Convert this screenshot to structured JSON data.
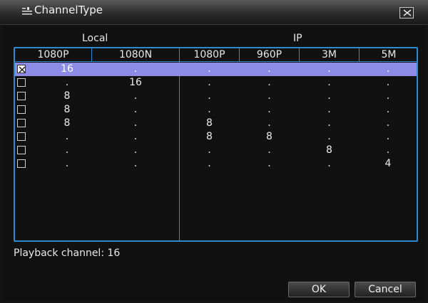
{
  "window": {
    "title": "ChannelType",
    "close_icon": "close-icon"
  },
  "groups": {
    "local": "Local",
    "ip": "IP"
  },
  "columns": [
    "1080P",
    "1080N",
    "1080P",
    "960P",
    "3M",
    "5M"
  ],
  "rows": [
    {
      "checked": true,
      "selected": true,
      "cells": [
        "16",
        ".",
        ".",
        ".",
        ".",
        "."
      ]
    },
    {
      "checked": false,
      "selected": false,
      "cells": [
        ".",
        "16",
        ".",
        ".",
        ".",
        "."
      ]
    },
    {
      "checked": false,
      "selected": false,
      "cells": [
        "8",
        ".",
        ".",
        ".",
        ".",
        "."
      ]
    },
    {
      "checked": false,
      "selected": false,
      "cells": [
        "8",
        ".",
        ".",
        ".",
        ".",
        "."
      ]
    },
    {
      "checked": false,
      "selected": false,
      "cells": [
        "8",
        ".",
        "8",
        ".",
        ".",
        "."
      ]
    },
    {
      "checked": false,
      "selected": false,
      "cells": [
        ".",
        ".",
        "8",
        "8",
        ".",
        "."
      ]
    },
    {
      "checked": false,
      "selected": false,
      "cells": [
        ".",
        ".",
        ".",
        ".",
        "8",
        "."
      ]
    },
    {
      "checked": false,
      "selected": false,
      "cells": [
        ".",
        ".",
        ".",
        ".",
        ".",
        "4"
      ]
    }
  ],
  "playback": "Playback channel: 16",
  "buttons": {
    "ok": "OK",
    "cancel": "Cancel"
  },
  "colors": {
    "accent_border": "#2f8ad0",
    "selected_row": "#8c8ce6"
  }
}
